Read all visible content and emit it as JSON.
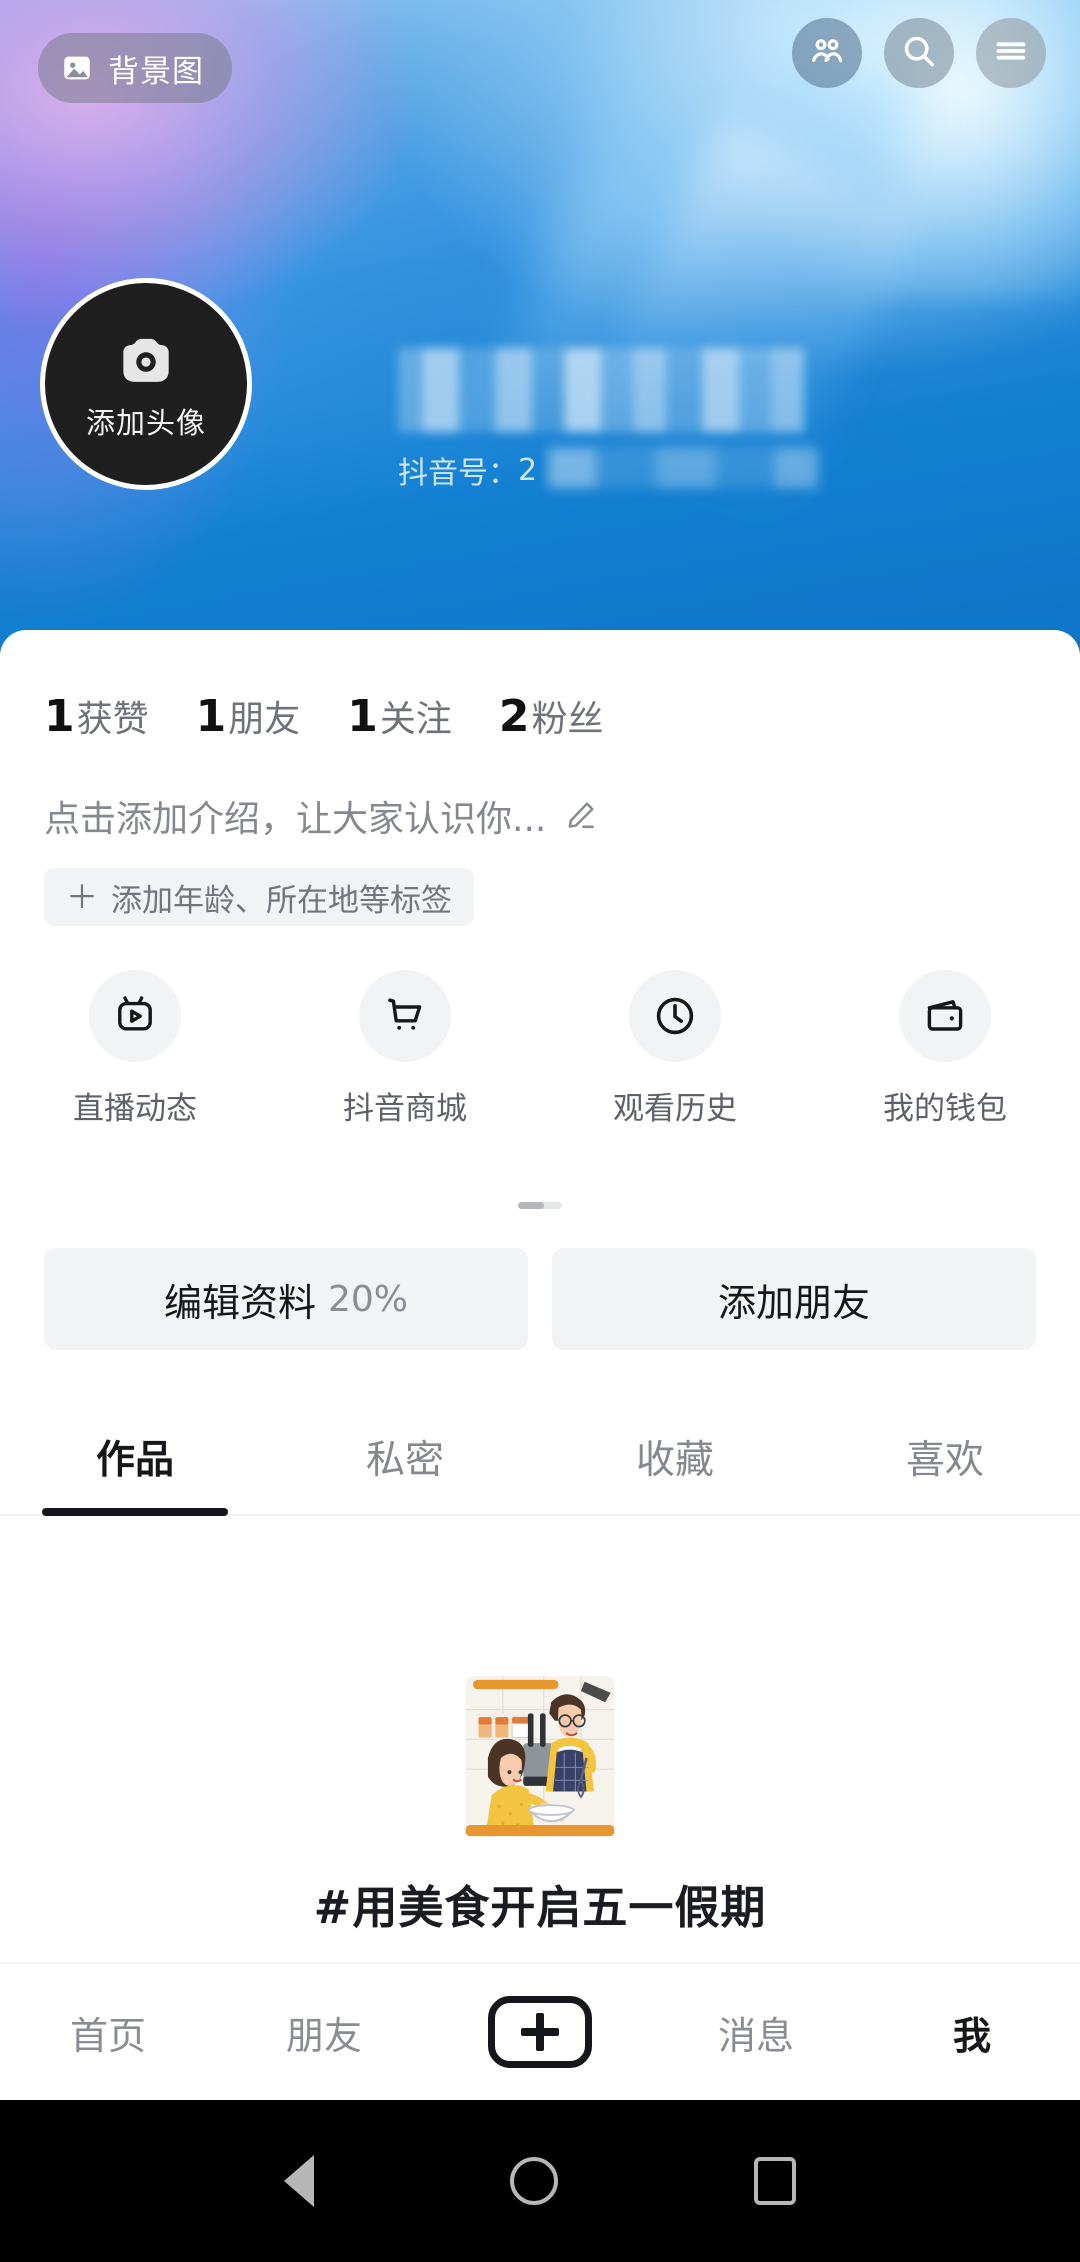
{
  "banner": {
    "bg_chip": {
      "label": "背景图",
      "icon": "image-icon"
    },
    "header_icons": [
      {
        "name": "friends-icon",
        "label": "朋友"
      },
      {
        "name": "search-icon",
        "label": "搜索"
      },
      {
        "name": "menu-icon",
        "label": "菜单"
      }
    ],
    "avatar": {
      "caption": "添加头像",
      "icon": "camera-icon"
    },
    "profile": {
      "nickname": "",
      "nickname_redacted": true,
      "id_label": "抖音号：",
      "id_value": "2",
      "id_redacted": true
    }
  },
  "stats": [
    {
      "num": "1",
      "label": "获赞"
    },
    {
      "num": "1",
      "label": "朋友"
    },
    {
      "num": "1",
      "label": "关注"
    },
    {
      "num": "2",
      "label": "粉丝"
    }
  ],
  "bio": {
    "placeholder": "点击添加介绍，让大家认识你...",
    "edit_icon": "pencil-icon"
  },
  "tag_button": {
    "plus": "＋",
    "label": "添加年龄、所在地等标签"
  },
  "quick_actions": [
    {
      "label": "直播动态",
      "icon": "live-tv-icon"
    },
    {
      "label": "抖音商城",
      "icon": "shopping-cart-icon"
    },
    {
      "label": "观看历史",
      "icon": "clock-icon"
    },
    {
      "label": "我的钱包",
      "icon": "wallet-icon"
    }
  ],
  "actions": {
    "edit_profile": {
      "label": "编辑资料",
      "percent": "20%"
    },
    "add_friend": {
      "label": "添加朋友"
    }
  },
  "tabs": [
    {
      "label": "作品",
      "active": true
    },
    {
      "label": "私密",
      "active": false
    },
    {
      "label": "收藏",
      "active": false
    },
    {
      "label": "喜欢",
      "active": false
    }
  ],
  "promo": {
    "title": "#用美食开启五一假期",
    "illustration": "cooking-couple-illustration"
  },
  "bottom_nav": [
    {
      "label": "首页",
      "active": false
    },
    {
      "label": "朋友",
      "active": false
    },
    {
      "label": "",
      "active": false,
      "icon": "plus-icon"
    },
    {
      "label": "消息",
      "active": false
    },
    {
      "label": "我",
      "active": true
    }
  ],
  "system_nav": [
    {
      "name": "back-button"
    },
    {
      "name": "home-button"
    },
    {
      "name": "recents-button"
    }
  ],
  "colors": {
    "banner_blue": "#1380d2",
    "accent_dark": "#16171a",
    "muted_text": "#86888f",
    "chip_bg": "#f2f3f5"
  }
}
